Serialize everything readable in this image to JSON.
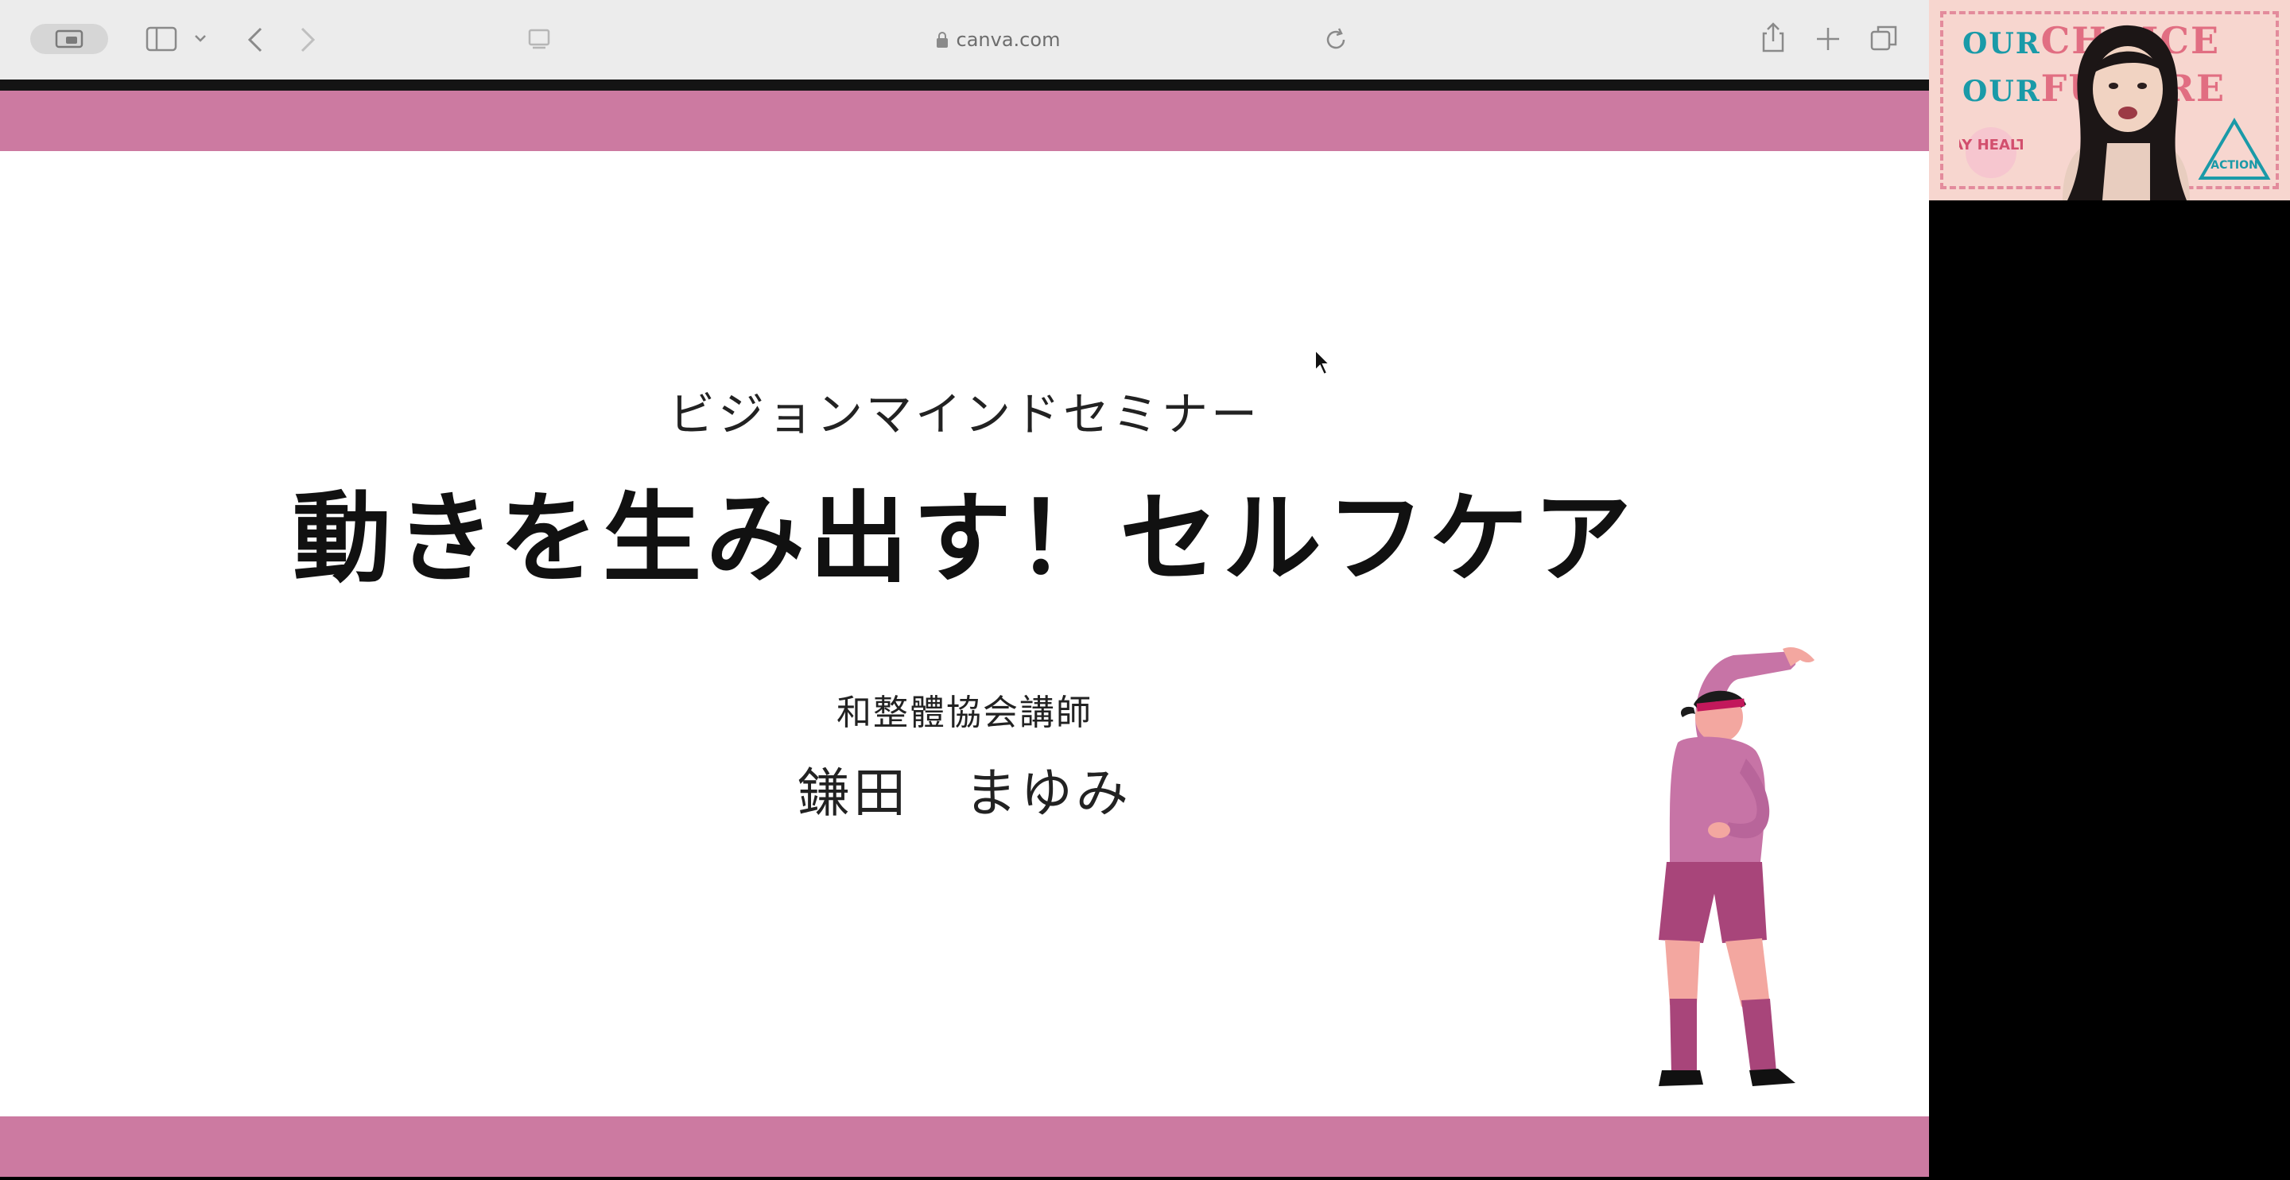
{
  "browser": {
    "url": "canva.com"
  },
  "slide": {
    "subtitle": "ビジョンマインドセミナー",
    "title": "動きを生み出す！セルフケア",
    "affiliation": "和整體協会講師",
    "presenter": "鎌田　まゆみ"
  },
  "webcam": {
    "line1_our": "OUR",
    "line1_word": "CHOICE",
    "line2_our": "OUR",
    "line2_word": "FUTURE",
    "badge_left": "STAY HEALTHY",
    "badge_right": "ACTION"
  },
  "colors": {
    "band": "#cc7aa1",
    "chrome": "#ececec",
    "figure_top": "#c774a6",
    "figure_shorts": "#a8457a"
  }
}
